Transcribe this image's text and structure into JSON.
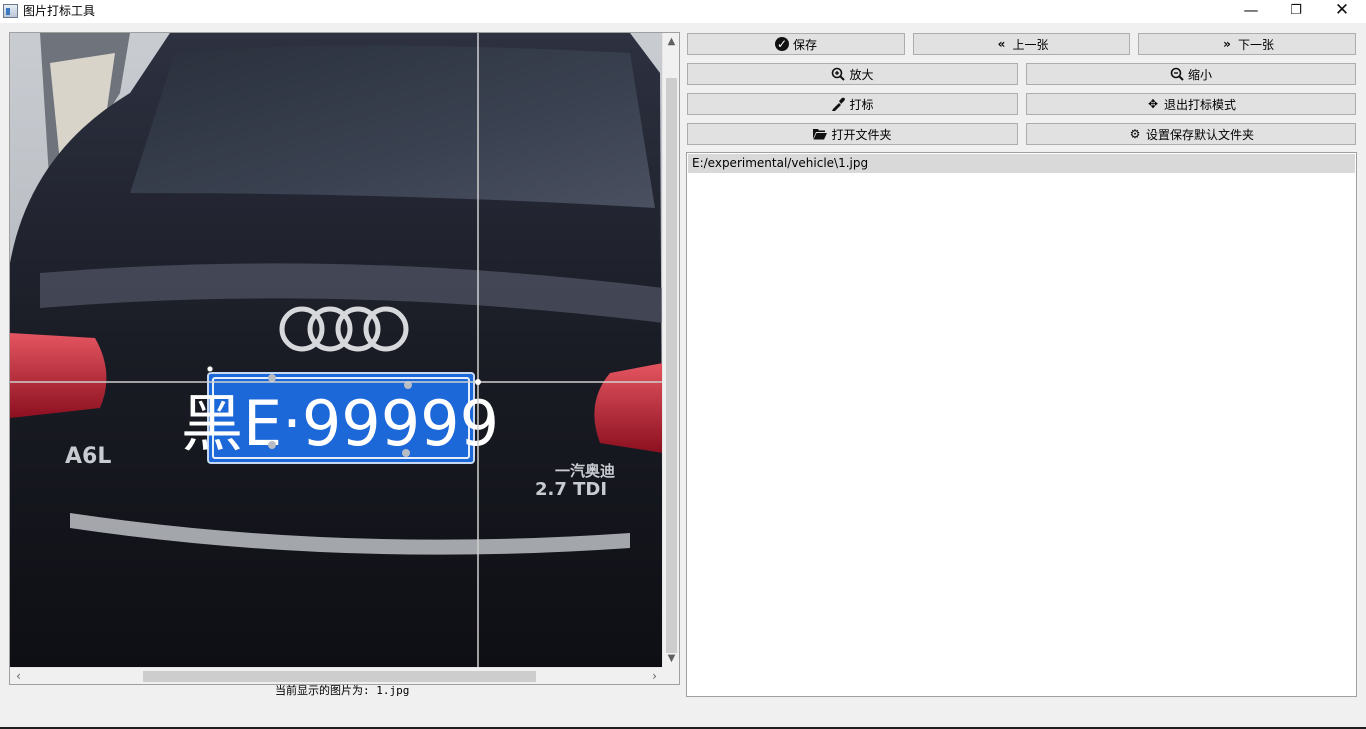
{
  "window": {
    "title": "图片打标工具",
    "minimize_icon": "minimize-icon",
    "maximize_icon": "restore-icon",
    "close_icon": "close-icon"
  },
  "viewer": {
    "image_name": "1.jpg",
    "plate_text": "黑E·99999",
    "car_badge": "A6L",
    "car_model_cn": "一汽奥迪",
    "car_engine": "2.7 TDI",
    "status_text": "当前显示的图片为: 1.jpg"
  },
  "toolbar": {
    "save_label": "保存",
    "prev_label": "上一张",
    "next_label": "下一张",
    "zoom_in_label": "放大",
    "zoom_out_label": "缩小",
    "mark_label": "打标",
    "exit_mark_label": "退出打标模式",
    "open_folder_label": "打开文件夹",
    "set_default_folder_label": "设置保存默认文件夹"
  },
  "files": {
    "items": [
      "E:/experimental/vehicle\\1.jpg"
    ]
  }
}
